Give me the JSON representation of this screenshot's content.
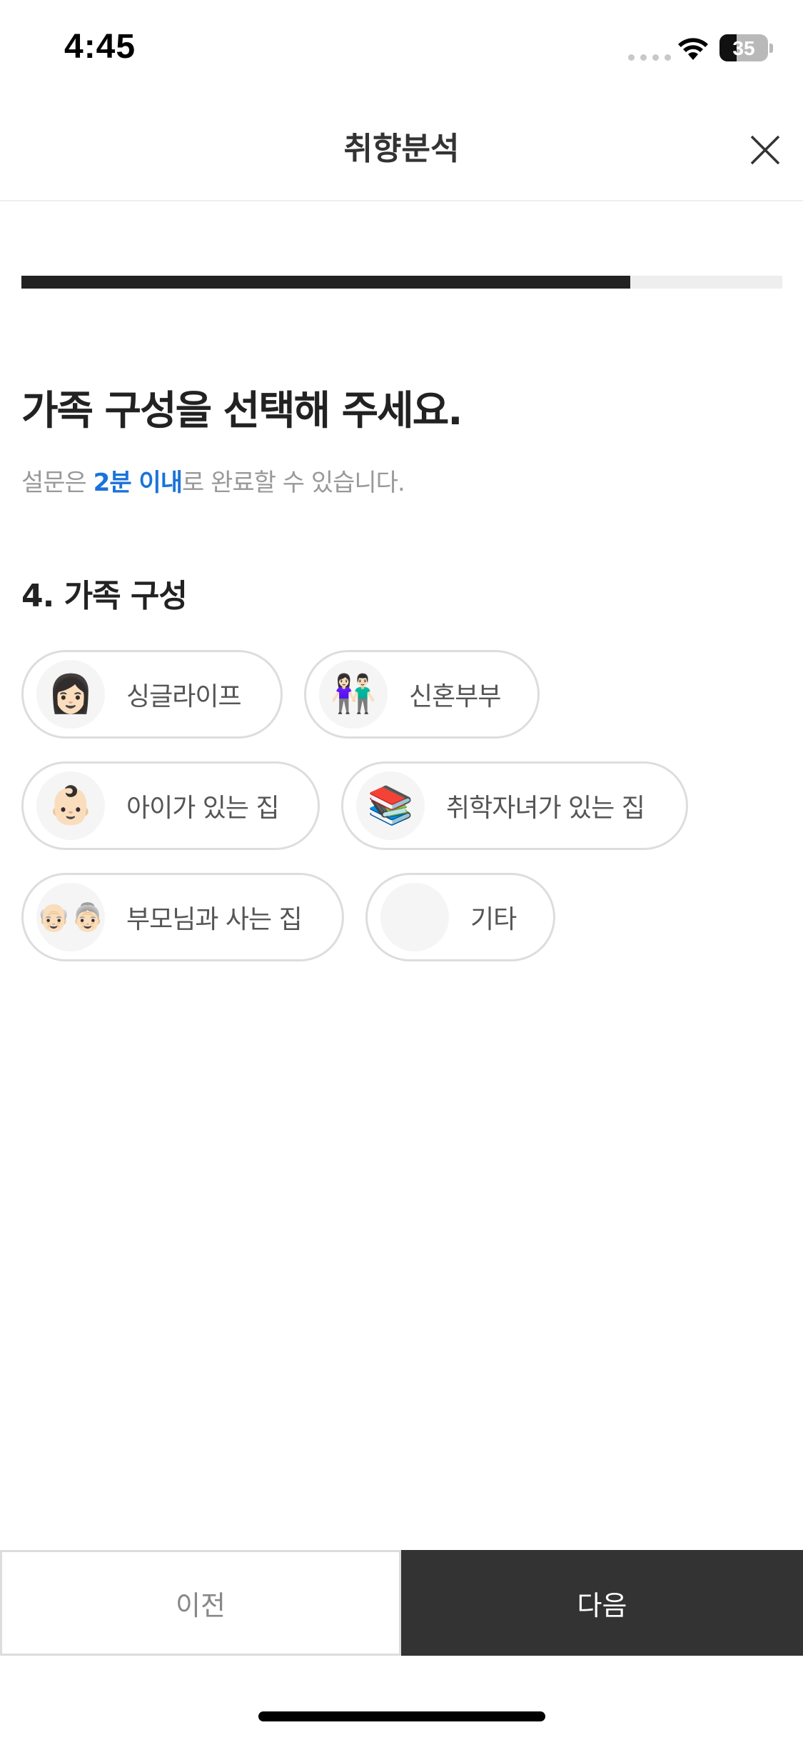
{
  "status_bar": {
    "time": "4:45",
    "battery_level": "35",
    "battery_fraction": 0.35
  },
  "header": {
    "title": "취향분석",
    "close_icon": "close-icon"
  },
  "progress": {
    "fraction": 0.8
  },
  "main": {
    "title": "가족 구성을 선택해 주세요.",
    "subtitle_prefix": "설문은 ",
    "subtitle_highlight": "2분 이내",
    "subtitle_suffix": "로 완료할 수 있습니다.",
    "section_title": "4. 가족 구성"
  },
  "options": [
    {
      "label": "싱글라이프",
      "icon": "woman-icon",
      "glyph": "👩🏻"
    },
    {
      "label": "신혼부부",
      "icon": "couple-icon",
      "glyph": "👫🏻"
    },
    {
      "label": "아이가 있는 집",
      "icon": "baby-icon",
      "glyph": "👶🏻"
    },
    {
      "label": "취학자녀가 있는 집",
      "icon": "books-icon",
      "glyph": "📚"
    },
    {
      "label": "부모님과 사는 집",
      "icon": "elderly-couple-icon",
      "glyph": "👴🏻👵🏻"
    },
    {
      "label": "기타",
      "icon": "blank-icon",
      "glyph": ""
    }
  ],
  "footer": {
    "prev_label": "이전",
    "next_label": "다음"
  },
  "colors": {
    "accent": "#1a73d9",
    "dark": "#333333",
    "progress": "#222222"
  }
}
